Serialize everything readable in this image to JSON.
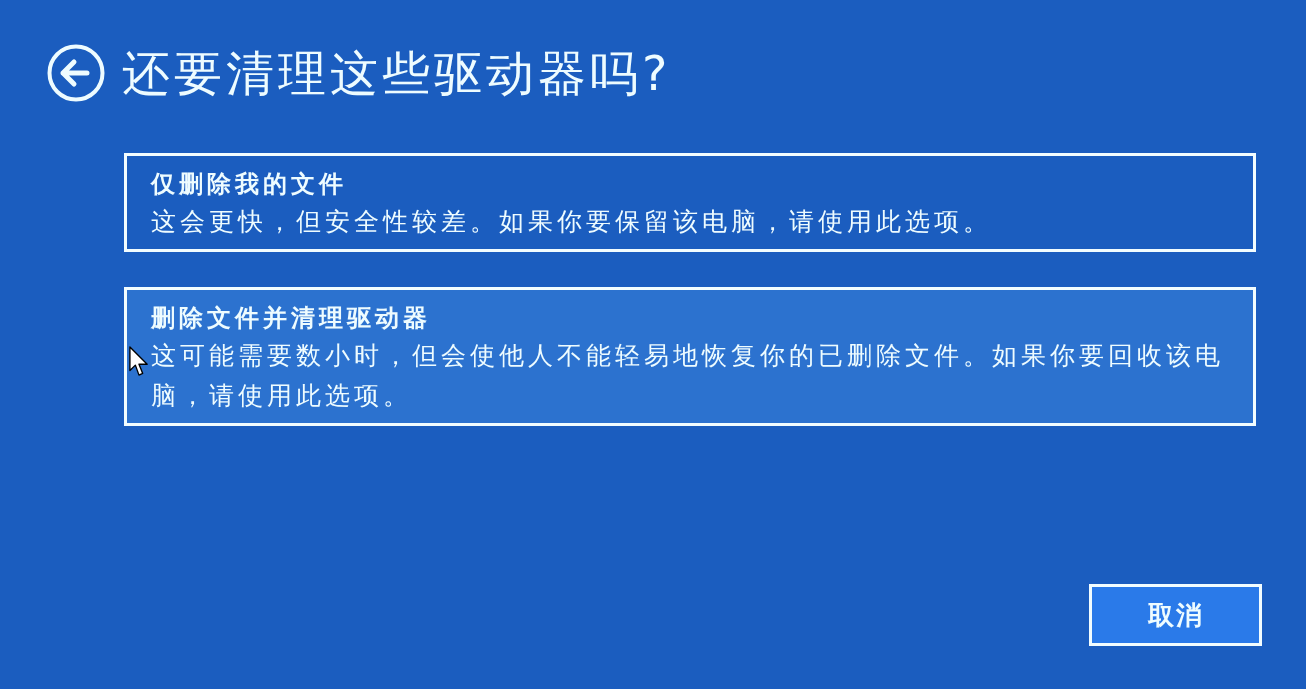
{
  "title": "还要清理这些驱动器吗?",
  "options": [
    {
      "title": "仅删除我的文件",
      "description": "这会更快，但安全性较差。如果你要保留该电脑，请使用此选项。",
      "selected": false
    },
    {
      "title": "删除文件并清理驱动器",
      "description": "这可能需要数小时，但会使他人不能轻易地恢复你的已删除文件。如果你要回收该电脑，请使用此选项。",
      "selected": true
    }
  ],
  "buttons": [
    "取消"
  ]
}
